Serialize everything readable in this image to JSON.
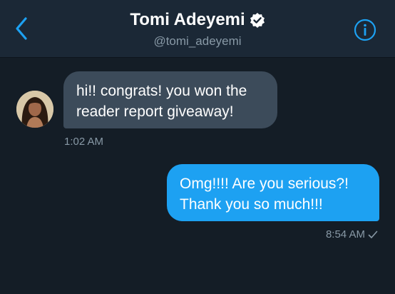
{
  "header": {
    "name": "Tomi Adeyemi",
    "handle": "@tomi_adeyemi",
    "back_icon": "chevron-left-icon",
    "verified_icon": "verified-badge-icon",
    "info_icon": "info-icon"
  },
  "messages": [
    {
      "direction": "incoming",
      "lines": [
        "hi!! congrats! you won the",
        "reader report giveaway!"
      ],
      "time": "1:02 AM"
    },
    {
      "direction": "outgoing",
      "lines": [
        "Omg!!!! Are you serious?!",
        "Thank you so much!!!"
      ],
      "time": "8:54 AM",
      "status_icon": "check-icon"
    }
  ],
  "colors": {
    "background": "#141d26",
    "header": "#1b2836",
    "accent": "#1da1f2",
    "incoming_bubble": "#3c4b5a",
    "secondary_text": "#8899a6"
  }
}
